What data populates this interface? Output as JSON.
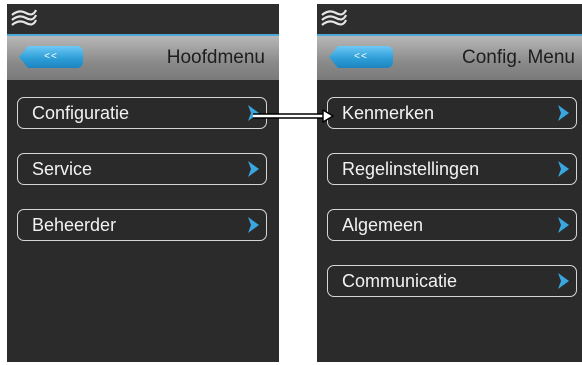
{
  "screens": [
    {
      "back_label": "<<",
      "title": "Hoofdmenu",
      "items": [
        {
          "label": "Configuratie"
        },
        {
          "label": "Service"
        },
        {
          "label": "Beheerder"
        }
      ]
    },
    {
      "back_label": "<<",
      "title": "Config. Menu",
      "items": [
        {
          "label": "Kenmerken"
        },
        {
          "label": "Regelinstellingen"
        },
        {
          "label": "Algemeen"
        },
        {
          "label": "Communicatie"
        }
      ]
    }
  ],
  "colors": {
    "accent": "#2f9fd8",
    "chevron": "#3aa6e0",
    "screen_bg": "#2b2b2b",
    "header_bg": "#9c9c9c",
    "item_border": "#d6d6d6"
  },
  "icons": {
    "logo": "wave-logo-icon",
    "chevron": "chevron-right-icon",
    "connector": "arrow-right-icon"
  }
}
